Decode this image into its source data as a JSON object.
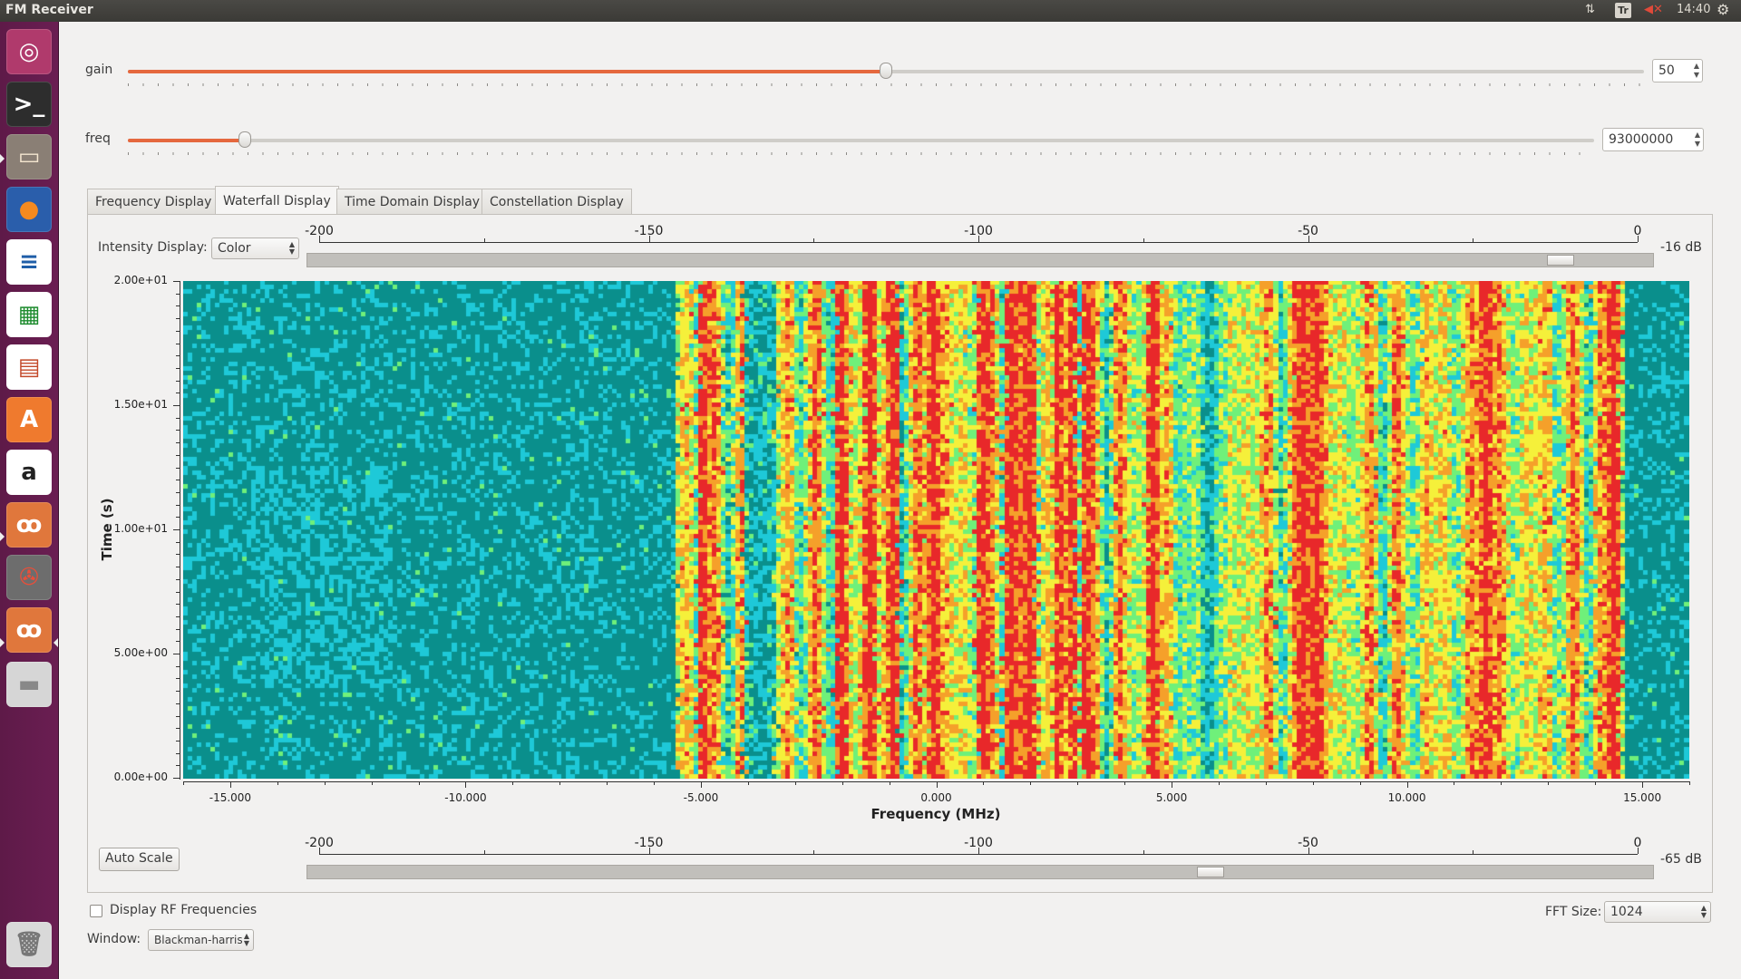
{
  "topbar": {
    "title": "FM Receiver",
    "net_icon": "⇅",
    "keyboard": "Tr",
    "volume_icon": "◀✕",
    "time": "14:40",
    "gear_icon": "⚙"
  },
  "launcher": {
    "items": [
      {
        "name": "ubuntu-dash-icon",
        "glyph": "◎",
        "bg": "#b03a6c",
        "fg": "#ffffff"
      },
      {
        "name": "terminal-icon",
        "glyph": ">_",
        "bg": "#2d2d2d",
        "fg": "#ffffff"
      },
      {
        "name": "files-icon",
        "glyph": "▭",
        "bg": "#8a7f75",
        "fg": "#f4e6d0"
      },
      {
        "name": "firefox-icon",
        "glyph": "●",
        "bg": "#2a5eab",
        "fg": "#f58a1f"
      },
      {
        "name": "writer-icon",
        "glyph": "≡",
        "bg": "#ffffff",
        "fg": "#1f5ea8"
      },
      {
        "name": "calc-icon",
        "glyph": "▦",
        "bg": "#ffffff",
        "fg": "#1e8c2f"
      },
      {
        "name": "impress-icon",
        "glyph": "▤",
        "bg": "#ffffff",
        "fg": "#c3492a"
      },
      {
        "name": "software-center-icon",
        "glyph": "A",
        "bg": "#ef7a2e",
        "fg": "#ffffff"
      },
      {
        "name": "amazon-icon",
        "glyph": "a",
        "bg": "#ffffff",
        "fg": "#222222"
      },
      {
        "name": "gnuradio-icon",
        "glyph": "ꝏ",
        "bg": "#e0773c",
        "fg": "#ffffff"
      },
      {
        "name": "system-settings-icon",
        "glyph": "✇",
        "bg": "#6d6d6d",
        "fg": "#e84f3a"
      },
      {
        "name": "gnuradio-fm-icon",
        "glyph": "ꝏ",
        "bg": "#e0773c",
        "fg": "#ffffff"
      },
      {
        "name": "disk-icon",
        "glyph": "▬",
        "bg": "#d6d6d6",
        "fg": "#888888"
      },
      {
        "name": "trash-icon",
        "glyph": "🗑",
        "bg": "#d9d9d9",
        "fg": "#777777"
      }
    ]
  },
  "gain": {
    "label": "gain",
    "value": "50",
    "level": 0.5
  },
  "freq": {
    "label": "freq",
    "value": "93000000",
    "level": 0.08
  },
  "tabs": [
    "Frequency Display",
    "Waterfall Display",
    "Time Domain Display",
    "Constellation Display"
  ],
  "active_tab": 1,
  "intensity": {
    "label": "Intensity Display:",
    "value": "Color"
  },
  "top_scale": {
    "ticks": [
      "-200",
      "-150",
      "-100",
      "-50",
      "0"
    ],
    "db": "-16 dB",
    "level": 0.93
  },
  "bottom_scale": {
    "ticks": [
      "-200",
      "-150",
      "-100",
      "-50",
      "0"
    ],
    "db": "-65 dB",
    "level": 0.67
  },
  "auto_scale_label": "Auto Scale",
  "display_rf_label": "Display RF Frequencies",
  "window_label": "Window:",
  "window_value": "Blackman-harris",
  "fft_label": "FFT Size:",
  "fft_value": "1024",
  "chart_data": {
    "type": "heatmap",
    "xlabel": "Frequency (MHz)",
    "ylabel": "Time (s)",
    "x_ticks": [
      "-15.000",
      "-10.000",
      "-5.000",
      "0.000",
      "5.000",
      "10.000",
      "15.000"
    ],
    "y_ticks": [
      "2.00e+01",
      "1.50e+01",
      "1.00e+01",
      "5.00e+00",
      "0.00e+00"
    ],
    "xlim": [
      -16,
      16
    ],
    "ylim": [
      0,
      20
    ],
    "colormap": [
      "#0a8f8c",
      "#1ec9d8",
      "#6ff07a",
      "#f5f03a",
      "#f5a02a",
      "#e8282a"
    ],
    "noise_band_end_mhz": -5.5,
    "strong_carriers_mhz": [
      -4.95,
      -2.0,
      -1.4,
      -0.9,
      -0.05,
      1.0,
      1.6,
      2.0,
      2.6,
      2.9,
      3.2,
      4.6,
      7.8,
      8.1,
      11.7,
      14.4
    ]
  }
}
